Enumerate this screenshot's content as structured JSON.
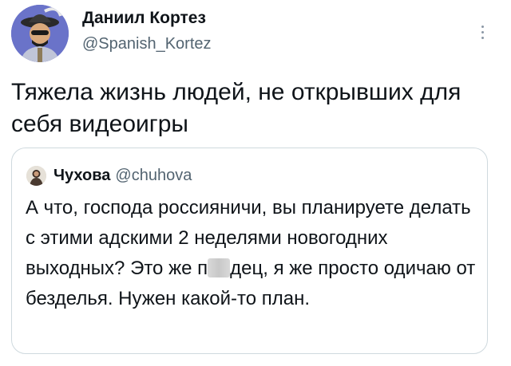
{
  "tweet": {
    "author": {
      "name": "Даниил Кортез",
      "handle": "@Spanish_Kortez",
      "avatar_icon": "avatar-illustration-icon"
    },
    "more_icon": "more-vertical-icon",
    "text": "Тяжела жизнь людей, не открывших для себя видеоигры",
    "quoted_tweet": {
      "author": {
        "name": "Чухова",
        "handle": "@chuhova",
        "avatar_icon": "avatar-photo-icon"
      },
      "text_before_censor": "А что, господа россияничи, вы планируете делать с этими адскими 2 неделями новогодних выходных? Это же п",
      "text_after_censor": "дец, я же просто одичаю от безделья. Нужен какой-то план."
    }
  },
  "colors": {
    "text_primary": "#0f1419",
    "text_secondary": "#536471",
    "border": "#cfd9de",
    "avatar_bg": "#6a73c9"
  }
}
